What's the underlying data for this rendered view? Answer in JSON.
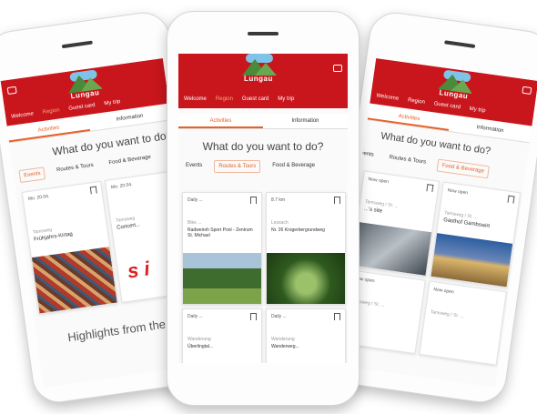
{
  "app": {
    "logo_text": "Lungau",
    "nav": [
      "Welcome",
      "Region",
      "Guest card",
      "My trip"
    ],
    "nav_active": "Region"
  },
  "tabs": {
    "activities": "Activities",
    "information": "Information"
  },
  "heading": "What do you want to do?",
  "chips": [
    "Events",
    "Routes & Tours",
    "Food & Beverage"
  ],
  "center_cards": [
    {
      "date": "Daily ...",
      "category": "Bike ...",
      "title": "Radweiroh Sport Pool - Zentrum St. Michael"
    },
    {
      "date": "8.7 km",
      "category": "Lessach",
      "title": "Nr. 26 Krogerbergrundweg"
    },
    {
      "date": "Daily ...",
      "category": "Wanderung",
      "title": "Überlingtal..."
    },
    {
      "date": "Daily ...",
      "category": "Wanderung",
      "title": "Wanderweg..."
    }
  ],
  "left_cards": [
    {
      "date": "Mo. 20.04.",
      "category": "Tamsweg",
      "title": "Frühjahrs-Kirtag"
    },
    {
      "date": "Mo. 20.04.",
      "category": "Tamsweg",
      "title": "Concert..."
    }
  ],
  "right_cards": [
    {
      "date": "Now open",
      "category": "Tamsweg / St. ...",
      "title": "...'s site"
    },
    {
      "date": "Now open",
      "category": "Tamsweg / St. ...",
      "title": "Gasthof Gambswirt"
    },
    {
      "date": "Now open",
      "category": "Tamsweg / St. ...",
      "title": "..."
    },
    {
      "date": "Now open",
      "category": "Tamsweg / St. ...",
      "title": "..."
    }
  ],
  "highlights": "Highlights from the region",
  "colors": {
    "brand_red": "#c8161c",
    "accent_orange": "#e8602a"
  }
}
